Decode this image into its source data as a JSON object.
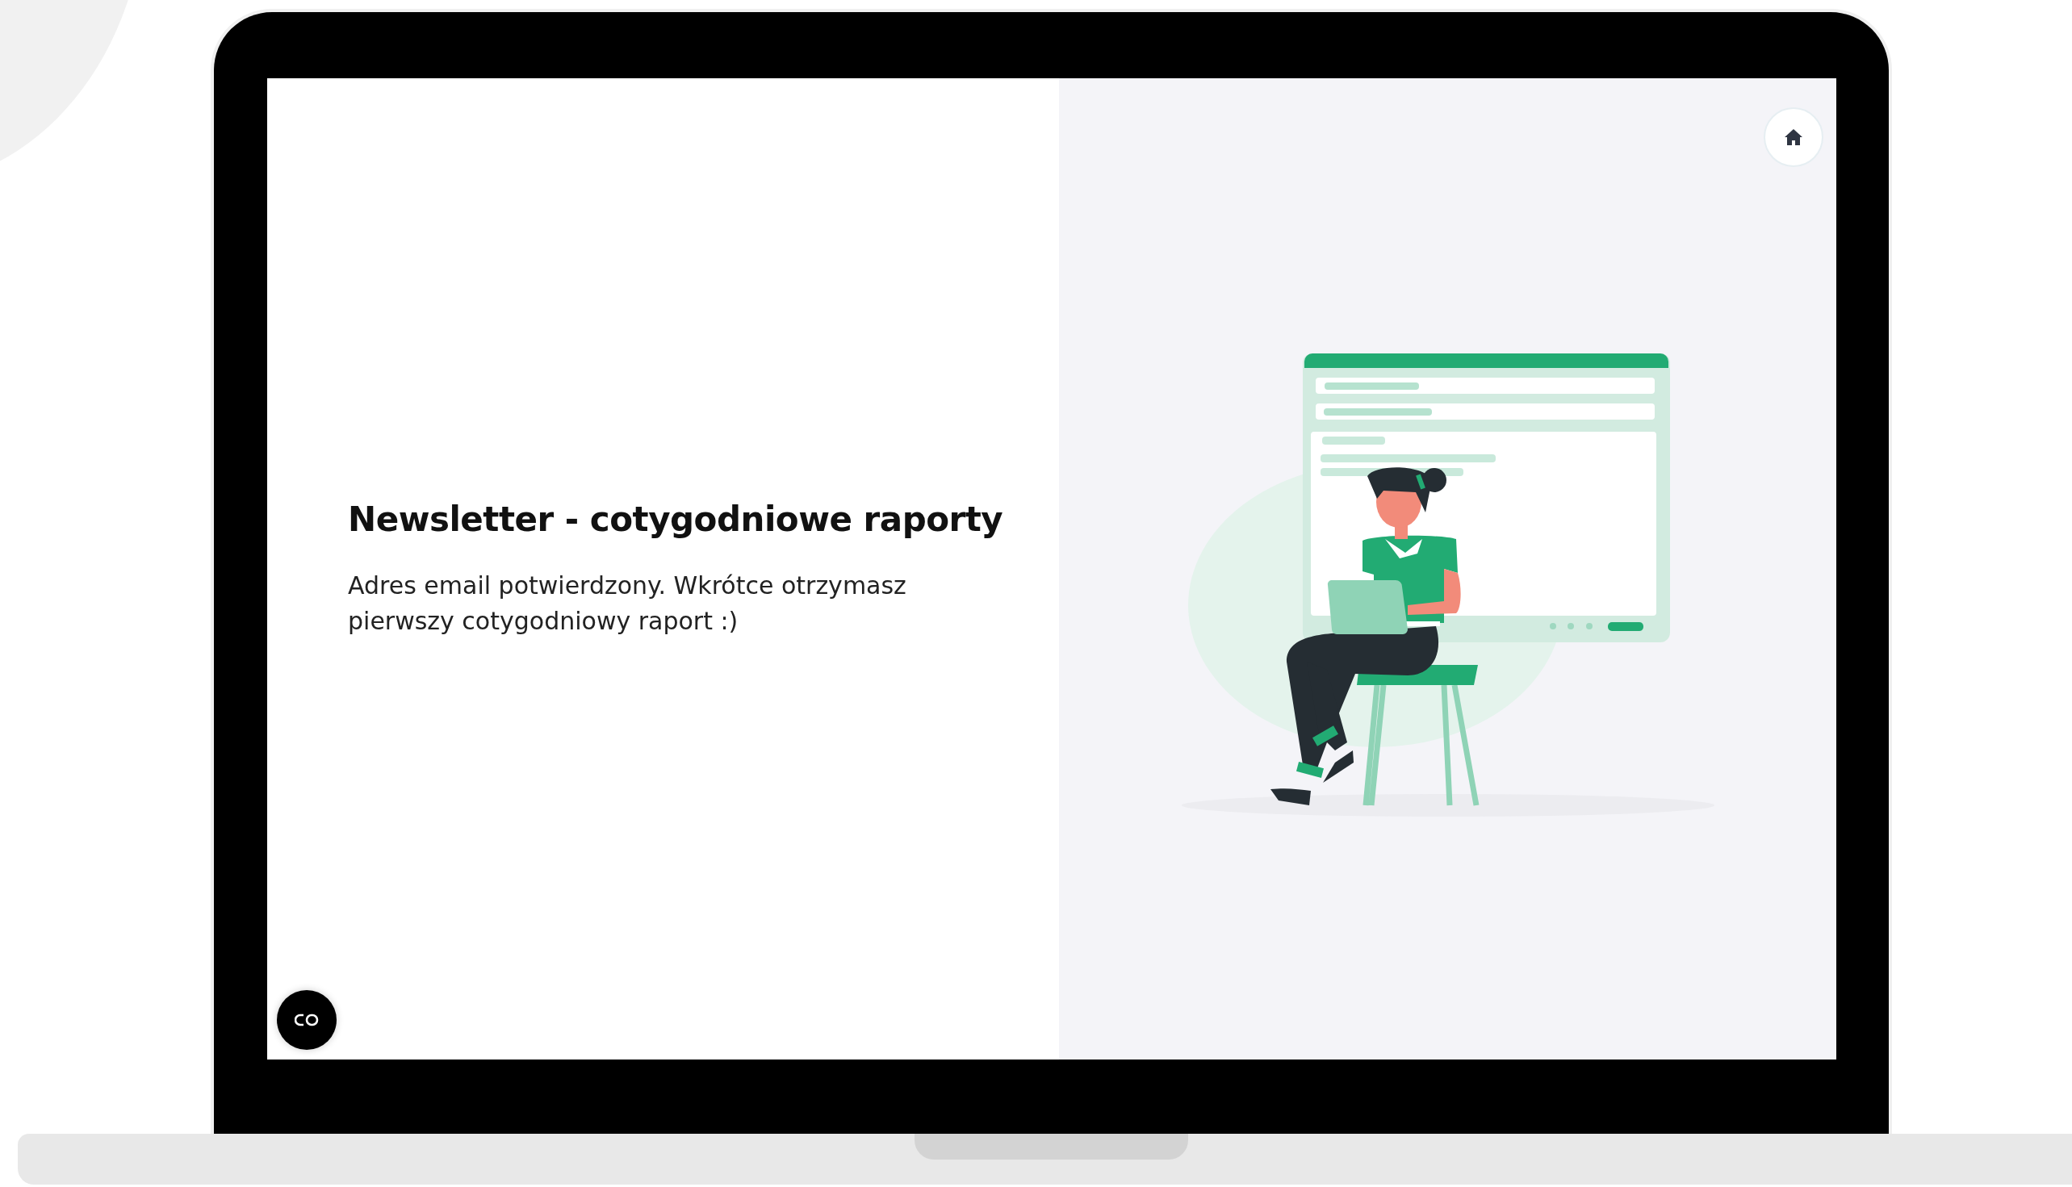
{
  "heading": "Newsletter - cotygodniowe raporty",
  "message": "Adres email potwierdzony. Wkrótce otrzymasz pierwszy cotygodniowy raport :)"
}
